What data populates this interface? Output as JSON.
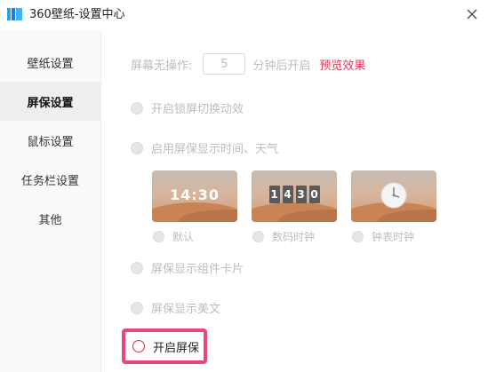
{
  "window": {
    "title": "360壁纸-设置中心"
  },
  "sidebar": {
    "items": [
      {
        "label": "壁纸设置"
      },
      {
        "label": "屏保设置"
      },
      {
        "label": "鼠标设置"
      },
      {
        "label": "任务栏设置"
      },
      {
        "label": "其他"
      }
    ],
    "active_index": 1
  },
  "idle": {
    "prefix": "屏幕无操作:",
    "value": "5",
    "suffix": "分钟后开启",
    "preview_link": "预览效果"
  },
  "options": {
    "lock_switch_anim": "开启锁屏切换动效",
    "show_time_weather": "启用屏保显示时间、天气",
    "show_widgets": "屏保显示组件卡片",
    "show_beauty": "屏保显示美文",
    "enable_screensaver": "开启屏保"
  },
  "clock_styles": [
    {
      "label": "默认",
      "preview_text": "14:30"
    },
    {
      "label": "数码时钟",
      "digits": [
        "1",
        "4",
        "3",
        "0"
      ]
    },
    {
      "label": "钟表时钟"
    }
  ],
  "colors": {
    "accent_red": "#e03b5a",
    "highlight_border": "#e8467c",
    "disabled_text": "#bdbdbd"
  }
}
